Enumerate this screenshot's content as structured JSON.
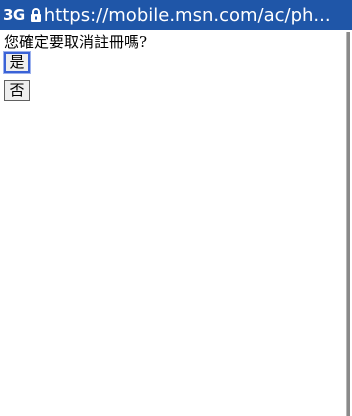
{
  "status_bar": {
    "network": "3G",
    "lock_icon": "lock-icon",
    "url": "https://mobile.msn.com/ac/ph...",
    "background_color": "#1f56a8"
  },
  "page": {
    "question": "您確定要取消註冊嗎?",
    "yes_label": "是",
    "no_label": "否"
  },
  "colors": {
    "focus_border": "#3a62d6"
  }
}
